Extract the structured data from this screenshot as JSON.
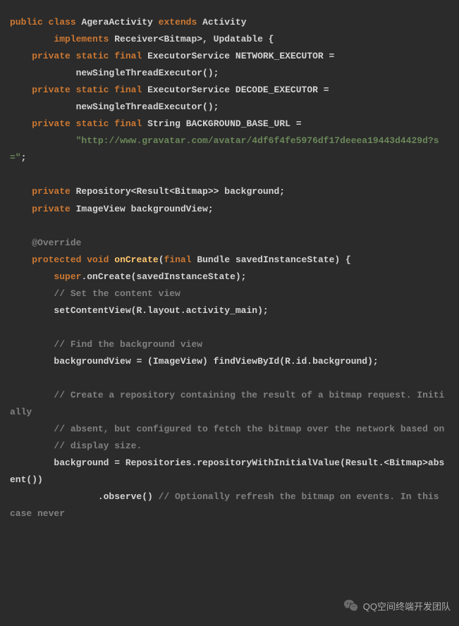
{
  "code": {
    "l1a": "public",
    "l1b": "class",
    "l1c": " AgeraActivity ",
    "l1d": "extends",
    "l1e": " Activity",
    "l2a": "        implements",
    "l2b": " Receiver<Bitmap>, Updatable {",
    "l3a": "    private",
    "l3b": "static",
    "l3c": "final",
    "l3d": " ExecutorService NETWORK_EXECUTOR =",
    "l4": "            newSingleThreadExecutor();",
    "l5a": "    private",
    "l5b": "static",
    "l5c": "final",
    "l5d": " ExecutorService DECODE_EXECUTOR =",
    "l6": "            newSingleThreadExecutor();",
    "l7a": "    private",
    "l7b": "static",
    "l7c": "final",
    "l7d": " String BACKGROUND_BASE_URL =",
    "l8": "            \"http://www.gravatar.com/avatar/4df6f4fe5976df17deeea19443d4429d?s=\"",
    "l8b": ";",
    "blank": "",
    "l9a": "    private",
    "l9b": " Repository<Result<Bitmap>> background;",
    "l10a": "    private",
    "l10b": " ImageView backgroundView;",
    "l11": "    @Override",
    "l12a": "    protected",
    "l12b": "void",
    "l12c": "onCreate",
    "l12d": "(",
    "l12e": "final",
    "l12f": " Bundle savedInstanceState) {",
    "l13a": "        super",
    "l13b": ".onCreate(savedInstanceState);",
    "l14": "        // Set the content view",
    "l15": "        setContentView(R.layout.activity_main);",
    "l16": "        // Find the background view",
    "l17": "        backgroundView = (ImageView) findViewById(R.id.background);",
    "l18": "        // Create a repository containing the result of a bitmap request. Initially",
    "l19": "        // absent, but configured to fetch the bitmap over the network based on",
    "l20": "        // display size.",
    "l21": "        background = Repositories.repositoryWithInitialValue(Result.<Bitmap>absent())",
    "l22a": "                .observe() ",
    "l22b": "// Optionally refresh the bitmap on events. In this case never"
  },
  "watermark": {
    "text": "QQ空间终端开发团队"
  }
}
